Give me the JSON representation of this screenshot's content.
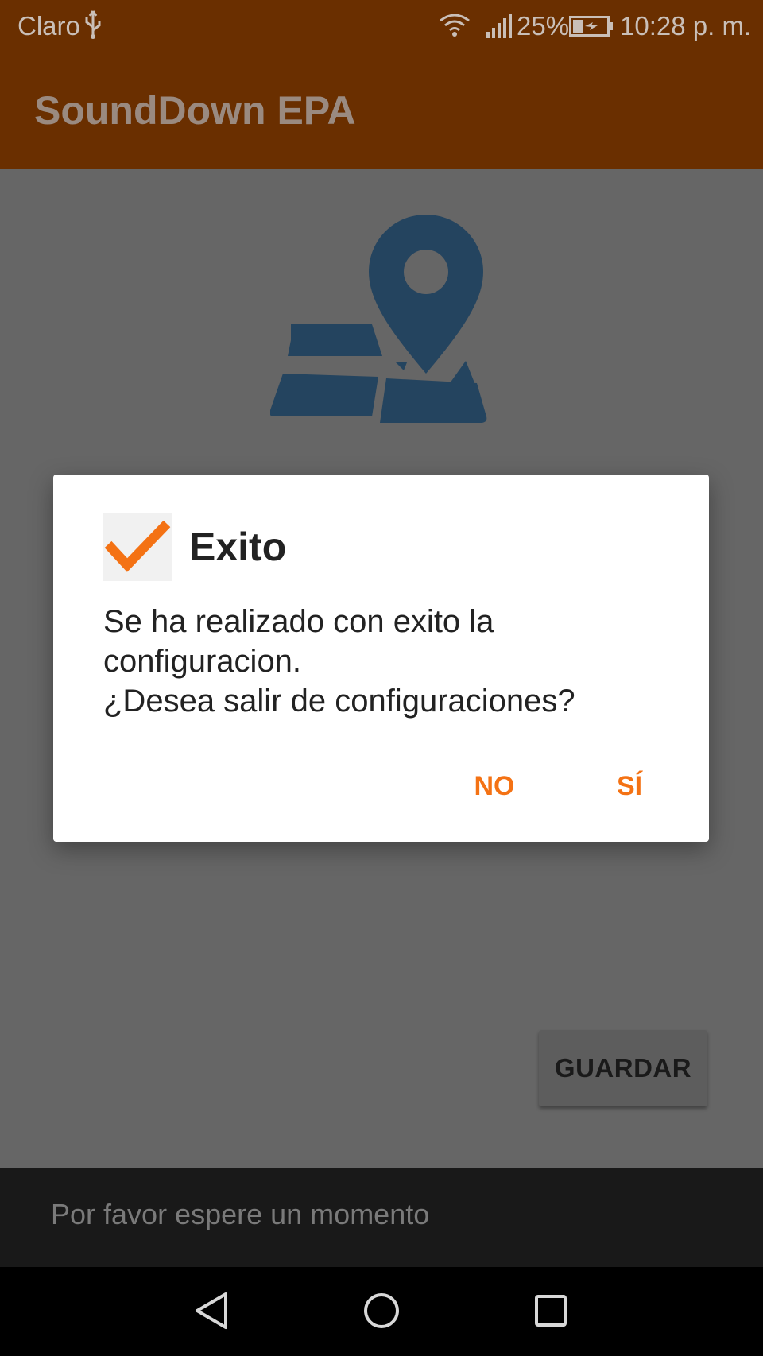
{
  "status_bar": {
    "carrier": "Claro",
    "battery_percent": "25%",
    "time": "10:28 p. m.",
    "icons": [
      "usb-icon",
      "wifi-icon",
      "signal-icon",
      "battery-charging-icon"
    ]
  },
  "app_bar": {
    "title": "SoundDown EPA"
  },
  "content": {
    "illustration": "map-location-icon",
    "save_label": "GUARDAR"
  },
  "dialog": {
    "icon": "checkmark-icon",
    "title": "Exito",
    "message": "Se ha realizado con exito la\nconfiguracion.\n¿Desea salir de configuraciones?",
    "no_label": "NO",
    "yes_label": "SÍ"
  },
  "snackbar": {
    "text": "Por favor espere un momento"
  },
  "nav_bar": {
    "icons": [
      "back-icon",
      "home-icon",
      "recent-apps-icon"
    ]
  },
  "colors": {
    "bar": "#6a2f00",
    "accent": "#f47214",
    "map_icon": "#24445f",
    "scrim_background": "#666666"
  }
}
